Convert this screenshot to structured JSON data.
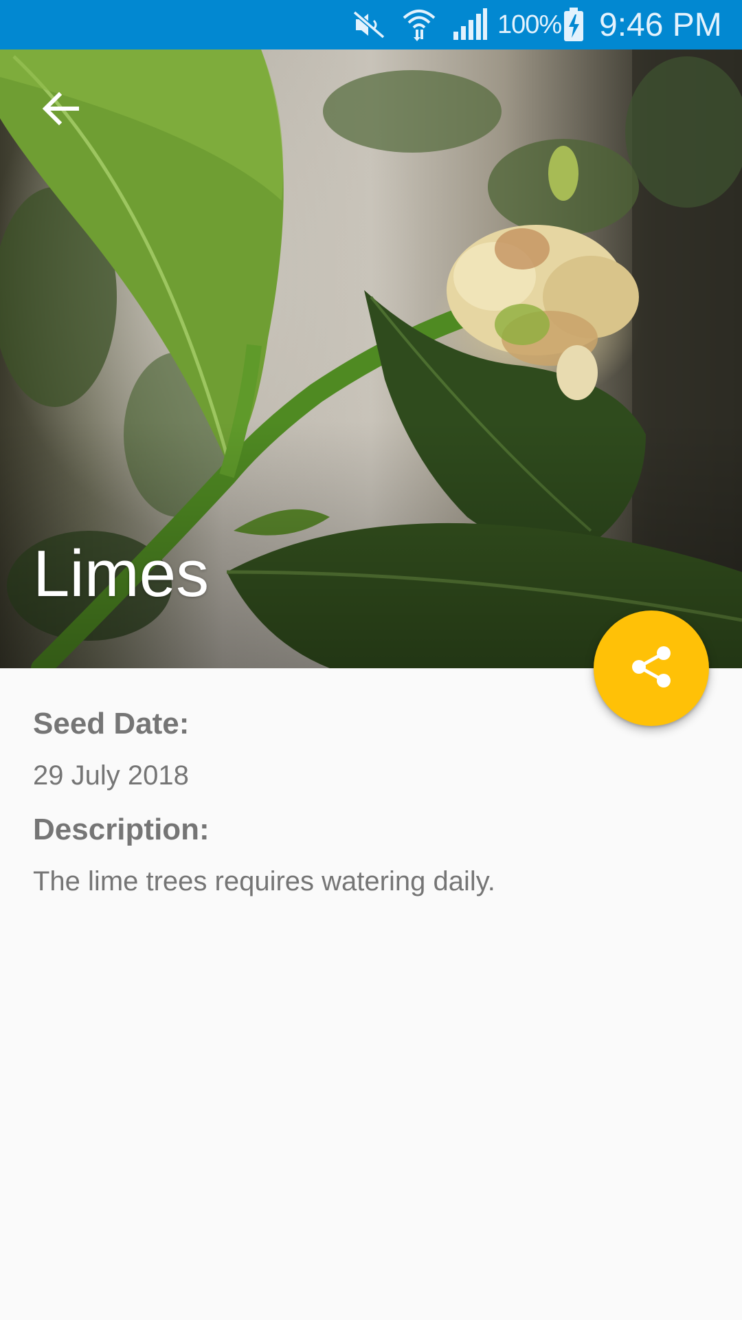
{
  "status_bar": {
    "battery_percent": "100%",
    "time": "9:46 PM",
    "icons": [
      "mute-icon",
      "wifi-icon",
      "signal-icon",
      "battery-charging-icon"
    ]
  },
  "header": {
    "title": "Limes",
    "back_icon": "arrow-back-icon"
  },
  "fab": {
    "icon": "share-icon",
    "color": "#ffc107"
  },
  "details": {
    "seed_date_label": "Seed Date:",
    "seed_date_value": "29 July 2018",
    "description_label": "Description:",
    "description_value": "The lime trees requires watering daily."
  },
  "colors": {
    "status_bar": "#0288d1",
    "accent": "#ffc107",
    "background": "#fafafa",
    "text_secondary": "#757575"
  }
}
